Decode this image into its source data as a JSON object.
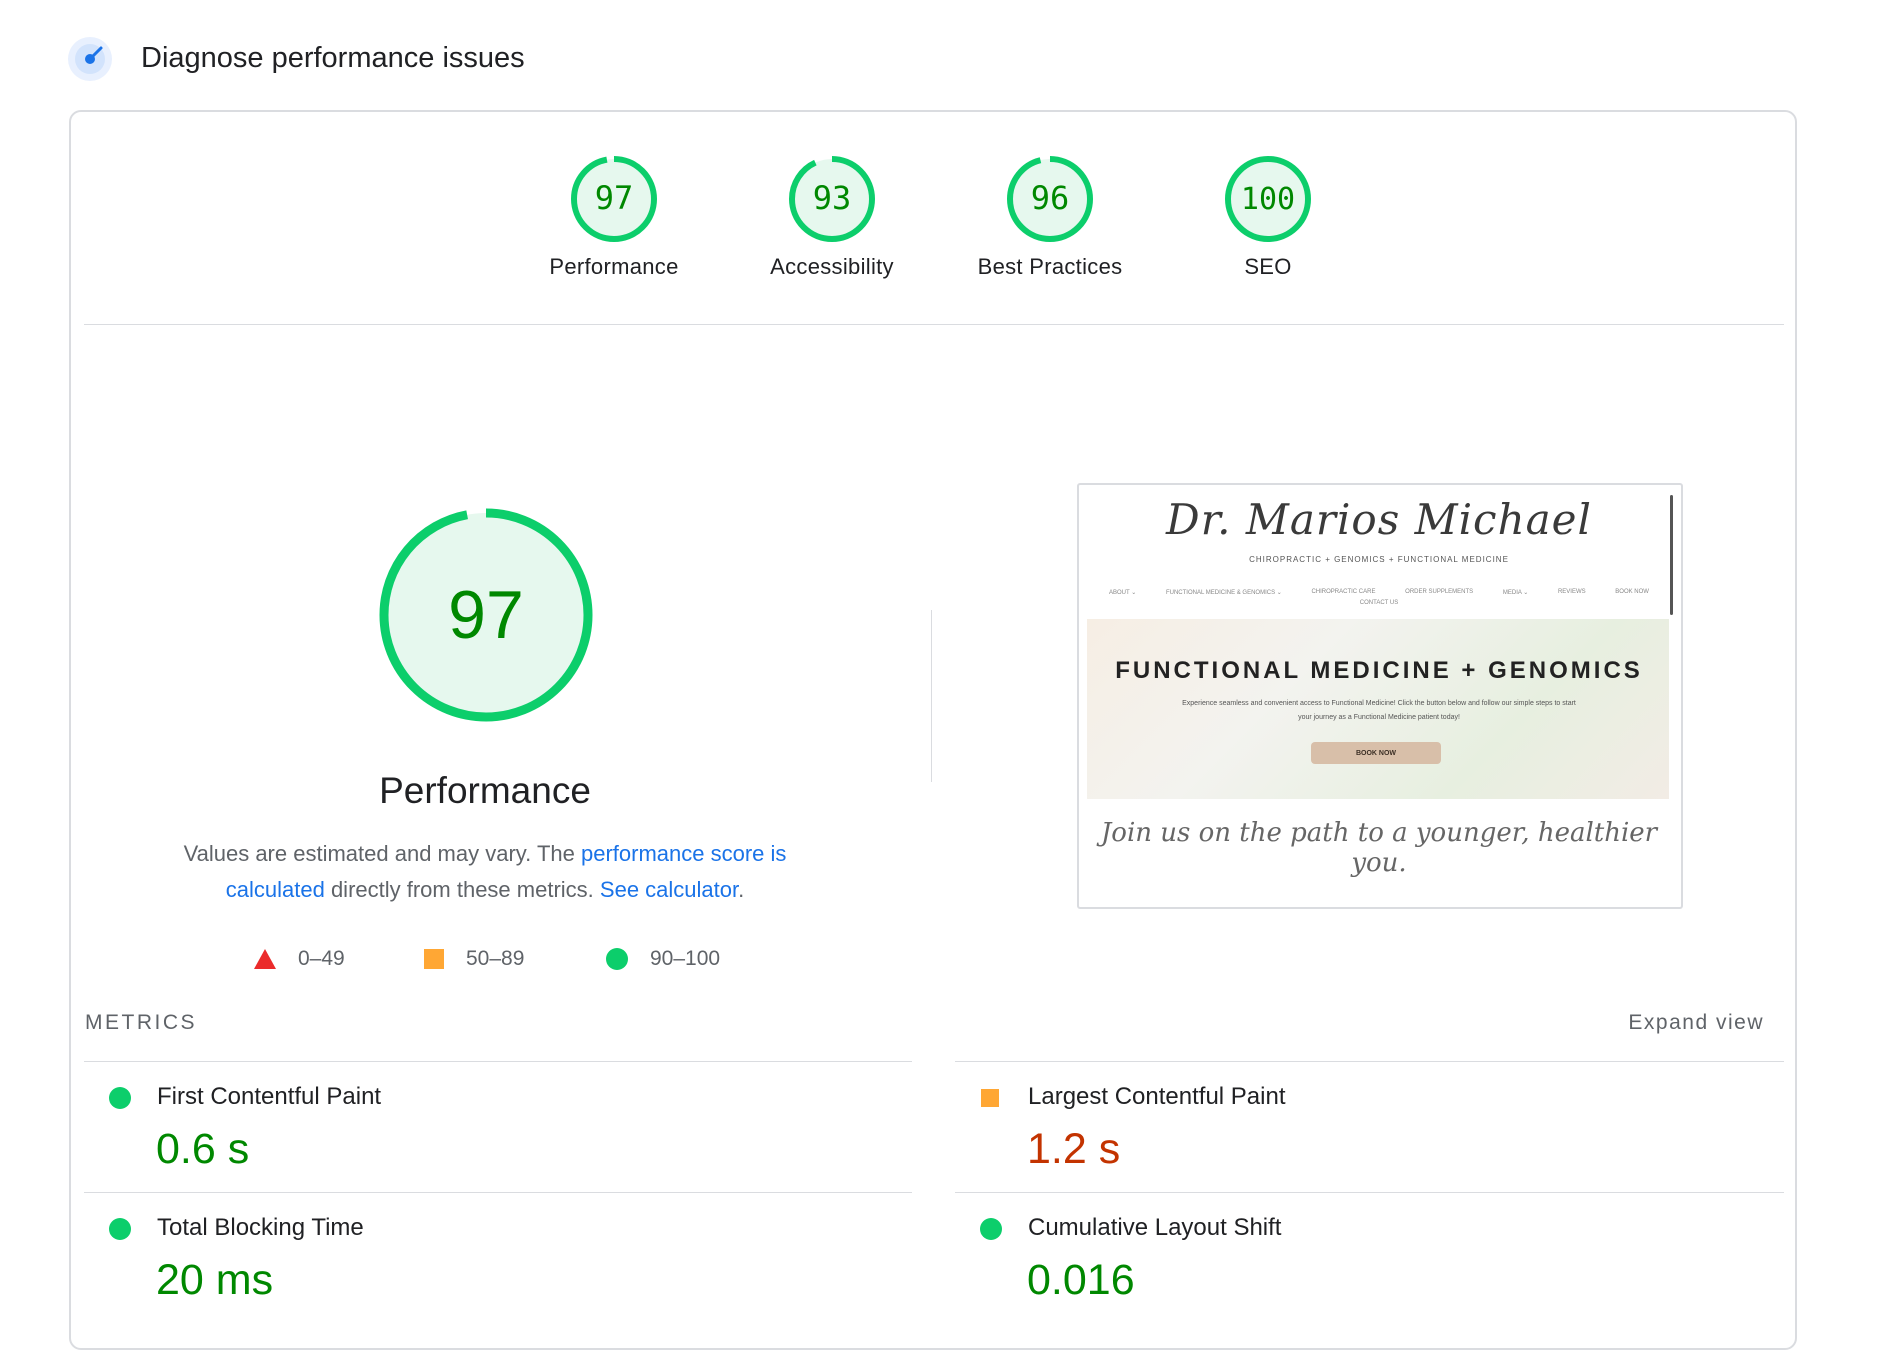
{
  "header": {
    "title": "Diagnose performance issues"
  },
  "categories": [
    {
      "score": "97",
      "label": "Performance",
      "score_value": 97
    },
    {
      "score": "93",
      "label": "Accessibility",
      "score_value": 93
    },
    {
      "score": "96",
      "label": "Best Practices",
      "score_value": 96
    },
    {
      "score": "100",
      "label": "SEO",
      "score_value": 100
    }
  ],
  "performance": {
    "score": "97",
    "score_value": 97,
    "title": "Performance",
    "desc_1": "Values are estimated and may vary. The ",
    "link_score": "performance score is calculated",
    "desc_2": " directly from these metrics. ",
    "link_calc": "See calculator",
    "desc_3": "."
  },
  "legend": {
    "fail": "0–49",
    "average": "50–89",
    "pass": "90–100"
  },
  "screenshot": {
    "site_name": "Dr. Marios Michael",
    "subtitle": "CHIROPRACTIC + GENOMICS + FUNCTIONAL MEDICINE",
    "nav": [
      "ABOUT ⌄",
      "FUNCTIONAL MEDICINE & GENOMICS ⌄",
      "CHIROPRACTIC CARE",
      "ORDER SUPPLEMENTS",
      "MEDIA ⌄",
      "REVIEWS",
      "BOOK NOW"
    ],
    "nav_2": "CONTACT US",
    "hero_title": "FUNCTIONAL MEDICINE + GENOMICS",
    "hero_text": "Experience seamless and convenient access to Functional Medicine! Click the button below and follow our simple steps to start your journey as a Functional Medicine patient today!",
    "button": "BOOK NOW",
    "tagline": "Join us on the path to a younger, healthier you."
  },
  "metrics": {
    "header": "METRICS",
    "expand": "Expand view",
    "items": [
      {
        "name": "First Contentful Paint",
        "value": "0.6 s",
        "status": "pass"
      },
      {
        "name": "Largest Contentful Paint",
        "value": "1.2 s",
        "status": "average"
      },
      {
        "name": "Total Blocking Time",
        "value": "20 ms",
        "status": "pass"
      },
      {
        "name": "Cumulative Layout Shift",
        "value": "0.016",
        "status": "pass"
      }
    ]
  },
  "colors": {
    "pass": "#0cce6b",
    "pass_text": "#008800",
    "average": "#ffa734",
    "average_text": "#c33300",
    "fail": "#eb2b2b",
    "link": "#1a73e8"
  }
}
